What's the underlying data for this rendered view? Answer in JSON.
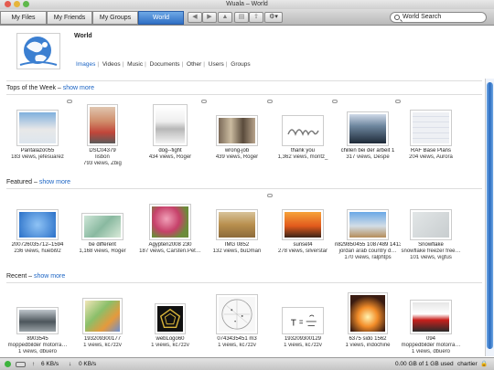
{
  "window": {
    "title": "Wuala – World"
  },
  "tabs": [
    {
      "label": "My Files"
    },
    {
      "label": "My Friends"
    },
    {
      "label": "My Groups"
    },
    {
      "label": "World"
    }
  ],
  "nav": {
    "back_icon": "back-arrow-icon",
    "forward_icon": "forward-arrow-icon",
    "up_icon": "up-arrow-icon",
    "gear_icon": "gear-icon"
  },
  "search": {
    "value": "World Search",
    "icon": "search-icon"
  },
  "header": {
    "title": "World",
    "filters": [
      "Images",
      "Videos",
      "Music",
      "Documents",
      "Other",
      "Users",
      "Groups"
    ]
  },
  "sections": {
    "top": {
      "title": "Tops of the Week",
      "more": "show more",
      "items": [
        {
          "name": "Pantalazo055",
          "sub": "",
          "views": "183 views, jefesuarez",
          "bubble": false
        },
        {
          "name": "DSC04379",
          "sub": "lisbon",
          "views": "793 views, Zbig",
          "bubble": true
        },
        {
          "name": "dog--fight",
          "sub": "",
          "views": "434 views, Roger",
          "bubble": false
        },
        {
          "name": "wrong-job",
          "sub": "",
          "views": "439 views, Roger",
          "bubble": true
        },
        {
          "name": "thank you",
          "sub": "",
          "views": "1,362 views, moritz_",
          "bubble": true
        },
        {
          "name": "chillen bei der arbeit 1",
          "sub": "",
          "views": "317 views, Despe",
          "bubble": true
        },
        {
          "name": "RAF Base Plans",
          "sub": "",
          "views": "204 views, Aurora",
          "bubble": true
        }
      ]
    },
    "featured": {
      "title": "Featured",
      "more": "show more",
      "items": [
        {
          "name": "200726035712–1594",
          "sub": "",
          "views": "236 views, huebi92",
          "bubble": false
        },
        {
          "name": "be different",
          "sub": "",
          "views": "1,168 views, Roger",
          "bubble": false
        },
        {
          "name": "Ägypten2008 230",
          "sub": "",
          "views": "187 views, Carsten.Pet…",
          "bubble": false
        },
        {
          "name": "IMG 0852",
          "sub": "",
          "views": "132 views, buDman",
          "bubble": false
        },
        {
          "name": "sunset4",
          "sub": "",
          "views": "278 views, silverstar",
          "bubble": true
        },
        {
          "name": "n829850455 1087489 1413",
          "sub": "jordan arab country d…",
          "views": "170 views, ralphtps",
          "bubble": false
        },
        {
          "name": "Snowflake",
          "sub": "snowflake freezer free…",
          "views": "101 views, vigfus",
          "bubble": false
        }
      ]
    },
    "recent": {
      "title": "Recent",
      "more": "show more",
      "items": [
        {
          "name": "8903545",
          "sub": "moppedbilder motorra…",
          "views": "1 views, dbuero",
          "bubble": false
        },
        {
          "name": "193209300177",
          "sub": "",
          "views": "1 views, kc7zzv",
          "bubble": false
        },
        {
          "name": "webLogo60",
          "sub": "",
          "views": "1 views, kc7zzv",
          "bubble": false
        },
        {
          "name": "0743435451  m3",
          "sub": "",
          "views": "1 views, kc7zzv",
          "bubble": false
        },
        {
          "name": "193209300129",
          "sub": "",
          "views": "1 views, kc7zzv",
          "bubble": false
        },
        {
          "name": "6375 sido 1562",
          "sub": "",
          "views": "1 views, indochine",
          "bubble": false
        },
        {
          "name": "094",
          "sub": "moppedbilder motorra…",
          "views": "1 views, dbuero",
          "bubble": false
        }
      ]
    }
  },
  "status": {
    "upload": "6 KB/s",
    "download": "0 KB/s",
    "storage": "0.00 GB of 1 GB used",
    "user": "chartier"
  },
  "colors": {
    "accent": "#2f6fc4",
    "link": "#1b64c4"
  }
}
